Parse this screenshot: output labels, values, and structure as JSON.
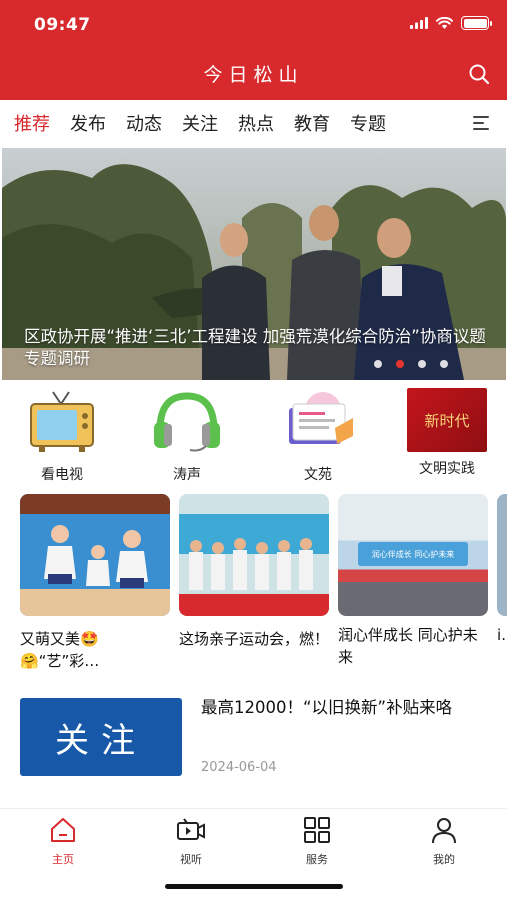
{
  "status_bar": {
    "time": "09:47",
    "battery_level": 1.0
  },
  "header": {
    "title": "今日松山",
    "search_icon": "search-icon"
  },
  "tabs": [
    {
      "label": "推荐",
      "active": true
    },
    {
      "label": "发布"
    },
    {
      "label": "动态"
    },
    {
      "label": "关注"
    },
    {
      "label": "热点"
    },
    {
      "label": "教育"
    },
    {
      "label": "专题"
    }
  ],
  "banner": {
    "caption": "区政协开展“推进‘三北’工程建设 加强荒漠化综合防治”协商议题专题调研",
    "slide_count": 4,
    "active_slide": 2
  },
  "quick_links": [
    {
      "label": "看电视",
      "icon": "tv-icon"
    },
    {
      "label": "涛声",
      "icon": "headphones-icon"
    },
    {
      "label": "文苑",
      "icon": "book-icon"
    },
    {
      "label": "文明实践",
      "icon": "new-era-banner-icon",
      "image_text": "新时代"
    }
  ],
  "cards": [
    {
      "title": "又萌又美🤩🤗“艺”彩…"
    },
    {
      "title": "这场亲子运动会，燃！"
    },
    {
      "title": "润心伴成长 同心护未来",
      "image_text": "润心伴成长 同心护未来"
    },
    {
      "title": "i…"
    }
  ],
  "news": {
    "thumb_text": "关注",
    "title": "最高12000！“以旧换新”补贴来咯",
    "date": "2024-06-04"
  },
  "bottom_nav": [
    {
      "label": "主页",
      "icon": "home-icon",
      "active": true
    },
    {
      "label": "视听",
      "icon": "video-icon"
    },
    {
      "label": "服务",
      "icon": "grid-icon"
    },
    {
      "label": "我的",
      "icon": "user-icon"
    }
  ],
  "colors": {
    "brand": "#d8292d",
    "news_thumb": "#1758a8"
  }
}
